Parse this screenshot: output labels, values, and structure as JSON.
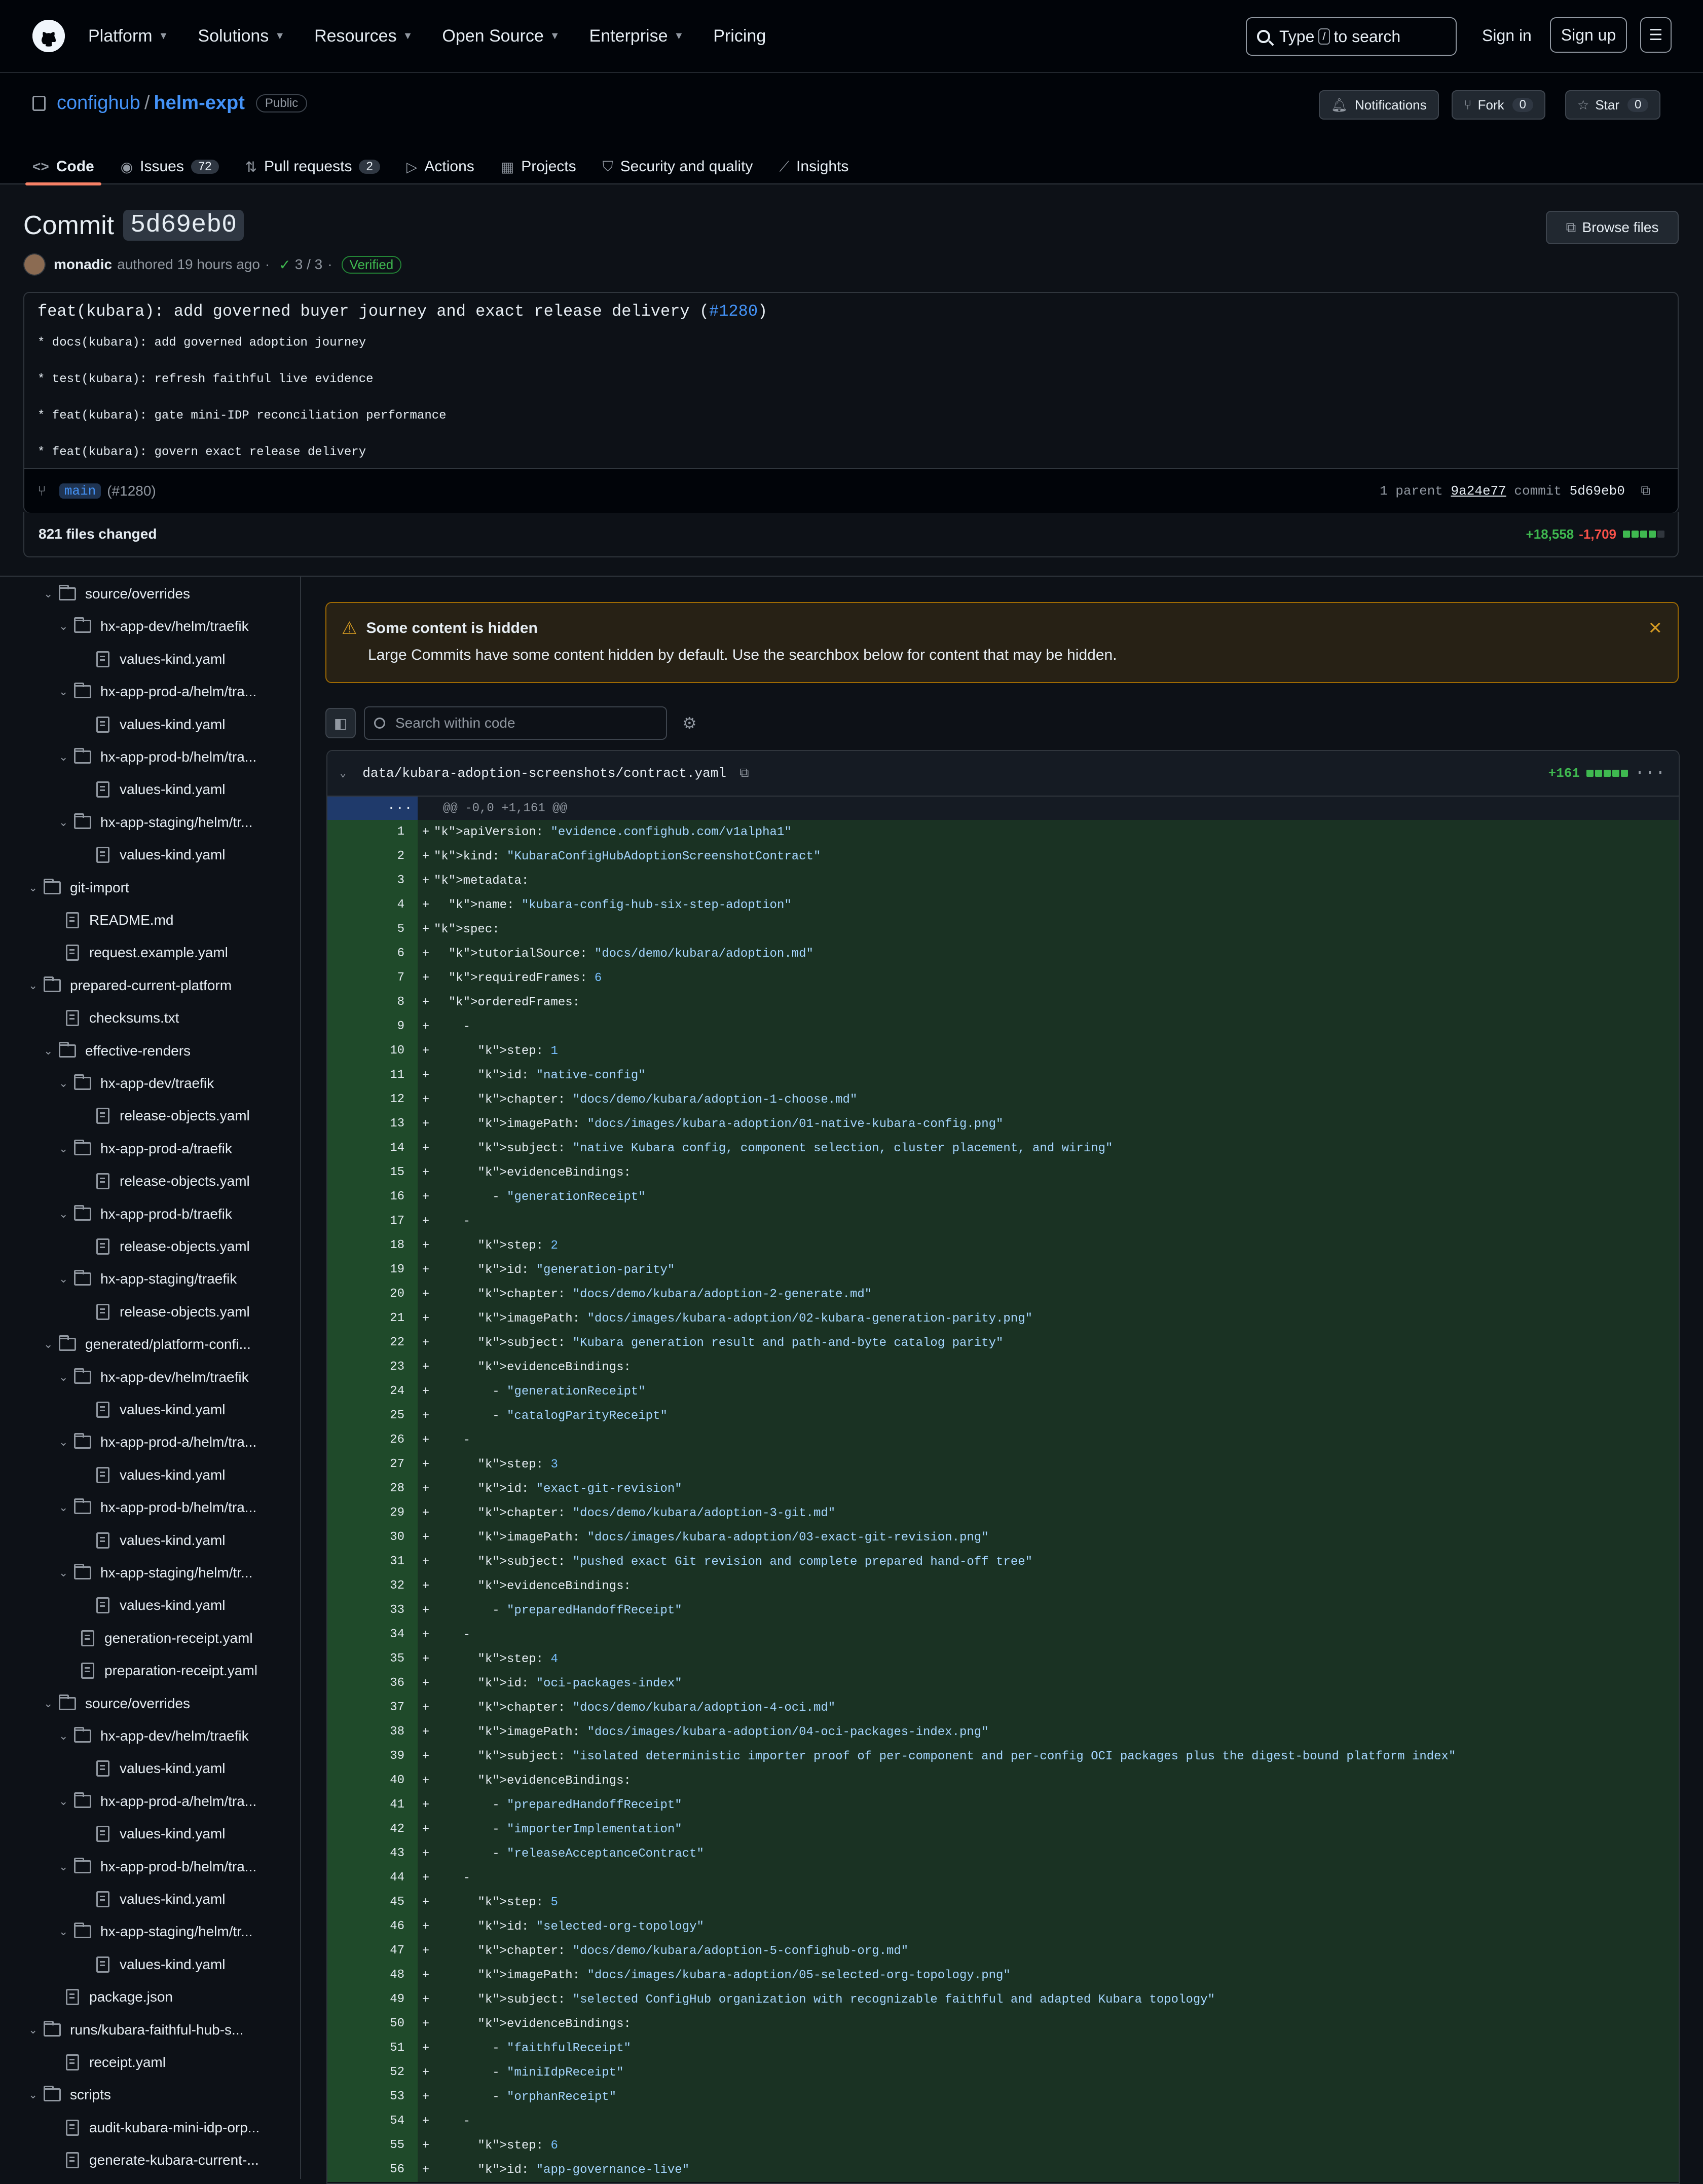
{
  "nav": {
    "items": [
      "Platform",
      "Solutions",
      "Resources",
      "Open Source",
      "Enterprise",
      "Pricing"
    ],
    "search_prefix": "Type",
    "search_key": "/",
    "search_suffix": "to search",
    "signin": "Sign in",
    "signup": "Sign up"
  },
  "repo": {
    "owner": "confighub",
    "separator": "/",
    "name": "helm-expt",
    "visibility": "Public",
    "notifications": "Notifications",
    "fork_label": "Fork",
    "fork_count": "0",
    "star_label": "Star",
    "star_count": "0",
    "tabs": [
      {
        "label": "Code",
        "count": ""
      },
      {
        "label": "Issues",
        "count": "72"
      },
      {
        "label": "Pull requests",
        "count": "2"
      },
      {
        "label": "Actions",
        "count": ""
      },
      {
        "label": "Projects",
        "count": ""
      },
      {
        "label": "Security and quality",
        "count": ""
      },
      {
        "label": "Insights",
        "count": ""
      }
    ]
  },
  "commit": {
    "heading": "Commit",
    "sha": "5d69eb0",
    "browse_files": "Browse files",
    "author": "monadic",
    "authored": "authored 19 hours ago",
    "dot": "·",
    "checks": "3 / 3",
    "verified": "Verified",
    "title_prefix": "feat(kubara): add governed buyer journey and exact release delivery (",
    "pr_link": "#1280",
    "title_suffix": ")",
    "body": [
      "* docs(kubara): add governed adoption journey",
      "* test(kubara): refresh faithful live evidence",
      "* feat(kubara): gate mini-IDP reconciliation performance",
      "* feat(kubara): govern exact release delivery"
    ],
    "branch": "main",
    "branch_pr": "(#1280)",
    "parent_label": "1 parent",
    "parent_sha": "9a24e77",
    "commit_label": "commit",
    "commit_sha": "5d69eb0",
    "files_changed": "821 files changed",
    "additions": "+18,558",
    "deletions": "-1,709"
  },
  "tree": [
    {
      "d": 1,
      "t": "folder",
      "label": "source/overrides"
    },
    {
      "d": 2,
      "t": "folder",
      "label": "hx-app-dev/helm/traefik"
    },
    {
      "d": 3,
      "t": "file",
      "label": "values-kind.yaml"
    },
    {
      "d": 2,
      "t": "folder",
      "label": "hx-app-prod-a/helm/tra..."
    },
    {
      "d": 3,
      "t": "file",
      "label": "values-kind.yaml"
    },
    {
      "d": 2,
      "t": "folder",
      "label": "hx-app-prod-b/helm/tra..."
    },
    {
      "d": 3,
      "t": "file",
      "label": "values-kind.yaml"
    },
    {
      "d": 2,
      "t": "folder",
      "label": "hx-app-staging/helm/tr..."
    },
    {
      "d": 3,
      "t": "file",
      "label": "values-kind.yaml"
    },
    {
      "d": 0,
      "t": "folder",
      "label": "git-import"
    },
    {
      "d": 1,
      "t": "file",
      "label": "README.md"
    },
    {
      "d": 1,
      "t": "file",
      "label": "request.example.yaml"
    },
    {
      "d": 0,
      "t": "folder",
      "label": "prepared-current-platform"
    },
    {
      "d": 1,
      "t": "file",
      "label": "checksums.txt"
    },
    {
      "d": 1,
      "t": "folder",
      "label": "effective-renders"
    },
    {
      "d": 2,
      "t": "folder",
      "label": "hx-app-dev/traefik"
    },
    {
      "d": 3,
      "t": "file",
      "label": "release-objects.yaml"
    },
    {
      "d": 2,
      "t": "folder",
      "label": "hx-app-prod-a/traefik"
    },
    {
      "d": 3,
      "t": "file",
      "label": "release-objects.yaml"
    },
    {
      "d": 2,
      "t": "folder",
      "label": "hx-app-prod-b/traefik"
    },
    {
      "d": 3,
      "t": "file",
      "label": "release-objects.yaml"
    },
    {
      "d": 2,
      "t": "folder",
      "label": "hx-app-staging/traefik"
    },
    {
      "d": 3,
      "t": "file",
      "label": "release-objects.yaml"
    },
    {
      "d": 1,
      "t": "folder",
      "label": "generated/platform-confi..."
    },
    {
      "d": 2,
      "t": "folder",
      "label": "hx-app-dev/helm/traefik"
    },
    {
      "d": 3,
      "t": "file",
      "label": "values-kind.yaml"
    },
    {
      "d": 2,
      "t": "folder",
      "label": "hx-app-prod-a/helm/tra..."
    },
    {
      "d": 3,
      "t": "file",
      "label": "values-kind.yaml"
    },
    {
      "d": 2,
      "t": "folder",
      "label": "hx-app-prod-b/helm/tra..."
    },
    {
      "d": 3,
      "t": "file",
      "label": "values-kind.yaml"
    },
    {
      "d": 2,
      "t": "folder",
      "label": "hx-app-staging/helm/tr..."
    },
    {
      "d": 3,
      "t": "file",
      "label": "values-kind.yaml"
    },
    {
      "d": 2,
      "t": "file",
      "label": "generation-receipt.yaml"
    },
    {
      "d": 2,
      "t": "file",
      "label": "preparation-receipt.yaml"
    },
    {
      "d": 1,
      "t": "folder",
      "label": "source/overrides"
    },
    {
      "d": 2,
      "t": "folder",
      "label": "hx-app-dev/helm/traefik"
    },
    {
      "d": 3,
      "t": "file",
      "label": "values-kind.yaml"
    },
    {
      "d": 2,
      "t": "folder",
      "label": "hx-app-prod-a/helm/tra..."
    },
    {
      "d": 3,
      "t": "file",
      "label": "values-kind.yaml"
    },
    {
      "d": 2,
      "t": "folder",
      "label": "hx-app-prod-b/helm/tra..."
    },
    {
      "d": 3,
      "t": "file",
      "label": "values-kind.yaml"
    },
    {
      "d": 2,
      "t": "folder",
      "label": "hx-app-staging/helm/tr..."
    },
    {
      "d": 3,
      "t": "file",
      "label": "values-kind.yaml"
    },
    {
      "d": 1,
      "t": "file",
      "label": "package.json"
    },
    {
      "d": 0,
      "t": "folder",
      "label": "runs/kubara-faithful-hub-s..."
    },
    {
      "d": 1,
      "t": "file",
      "label": "receipt.yaml"
    },
    {
      "d": 0,
      "t": "folder",
      "label": "scripts"
    },
    {
      "d": 1,
      "t": "file",
      "label": "audit-kubara-mini-idp-orp..."
    },
    {
      "d": 1,
      "t": "file",
      "label": "generate-kubara-current-..."
    }
  ],
  "notice": {
    "title": "Some content is hidden",
    "text": "Large Commits have some content hidden by default. Use the searchbox below for content that may be hidden."
  },
  "code_search": {
    "placeholder": "Search within code"
  },
  "diff": {
    "file_path": "data/kubara-adoption-screenshots/contract.yaml",
    "additions": "+161",
    "hunk": "@@ -0,0 +1,161 @@",
    "lines": [
      "apiVersion: \"evidence.confighub.com/v1alpha1\"",
      "kind: \"KubaraConfigHubAdoptionScreenshotContract\"",
      "metadata:",
      "  name: \"kubara-config-hub-six-step-adoption\"",
      "spec:",
      "  tutorialSource: \"docs/demo/kubara/adoption.md\"",
      "  requiredFrames: 6",
      "  orderedFrames:",
      "    -",
      "      step: 1",
      "      id: \"native-config\"",
      "      chapter: \"docs/demo/kubara/adoption-1-choose.md\"",
      "      imagePath: \"docs/images/kubara-adoption/01-native-kubara-config.png\"",
      "      subject: \"native Kubara config, component selection, cluster placement, and wiring\"",
      "      evidenceBindings:",
      "        - \"generationReceipt\"",
      "    -",
      "      step: 2",
      "      id: \"generation-parity\"",
      "      chapter: \"docs/demo/kubara/adoption-2-generate.md\"",
      "      imagePath: \"docs/images/kubara-adoption/02-kubara-generation-parity.png\"",
      "      subject: \"Kubara generation result and path-and-byte catalog parity\"",
      "      evidenceBindings:",
      "        - \"generationReceipt\"",
      "        - \"catalogParityReceipt\"",
      "    -",
      "      step: 3",
      "      id: \"exact-git-revision\"",
      "      chapter: \"docs/demo/kubara/adoption-3-git.md\"",
      "      imagePath: \"docs/images/kubara-adoption/03-exact-git-revision.png\"",
      "      subject: \"pushed exact Git revision and complete prepared hand-off tree\"",
      "      evidenceBindings:",
      "        - \"preparedHandoffReceipt\"",
      "    -",
      "      step: 4",
      "      id: \"oci-packages-index\"",
      "      chapter: \"docs/demo/kubara/adoption-4-oci.md\"",
      "      imagePath: \"docs/images/kubara-adoption/04-oci-packages-index.png\"",
      "      subject: \"isolated deterministic importer proof of per-component and per-config OCI packages plus the digest-bound platform index\"",
      "      evidenceBindings:",
      "        - \"preparedHandoffReceipt\"",
      "        - \"importerImplementation\"",
      "        - \"releaseAcceptanceContract\"",
      "    -",
      "      step: 5",
      "      id: \"selected-org-topology\"",
      "      chapter: \"docs/demo/kubara/adoption-5-confighub-org.md\"",
      "      imagePath: \"docs/images/kubara-adoption/05-selected-org-topology.png\"",
      "      subject: \"selected ConfigHub organization with recognizable faithful and adapted Kubara topology\"",
      "      evidenceBindings:",
      "        - \"faithfulReceipt\"",
      "        - \"miniIdpReceipt\"",
      "        - \"orphanReceipt\"",
      "    -",
      "      step: 6",
      "      id: \"app-governance-live\""
    ]
  }
}
